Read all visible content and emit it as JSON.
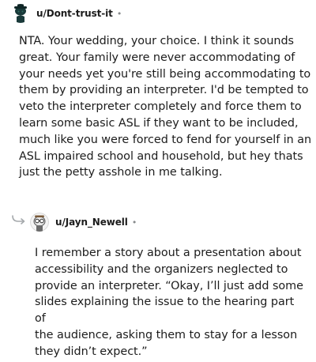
{
  "comments": [
    {
      "username": "u/Dont-trust-it",
      "separator": "•",
      "avatar_icon": "snoo-avatar-icon",
      "body": "NTA. Your wedding, your choice. I think it sounds\ngreat. Your family were never accommodating of\nyour needs yet you're still being accommodating to\nthem by providing an interpreter. I'd be tempted to\nveto the interpreter completely and force them to\nlearn some basic ASL if they want to be included,\nmuch like you were forced to fend for yourself in an\nASL impaired school and household, but hey thats\njust the petty asshole in me talking."
    },
    {
      "username": "u/Jayn_Newell",
      "separator": "•",
      "avatar_icon": "snoo-avatar-icon",
      "reply_icon": "reply-arrow-icon",
      "body": "I remember a story about a presentation about\naccessibility and the organizers neglected to\nprovide an interpreter. “Okay, I’ll just add some\nslides explaining the issue to the hearing part of\nthe audience, asking them to stay for a lesson\nthey didn’t expect.”"
    }
  ]
}
